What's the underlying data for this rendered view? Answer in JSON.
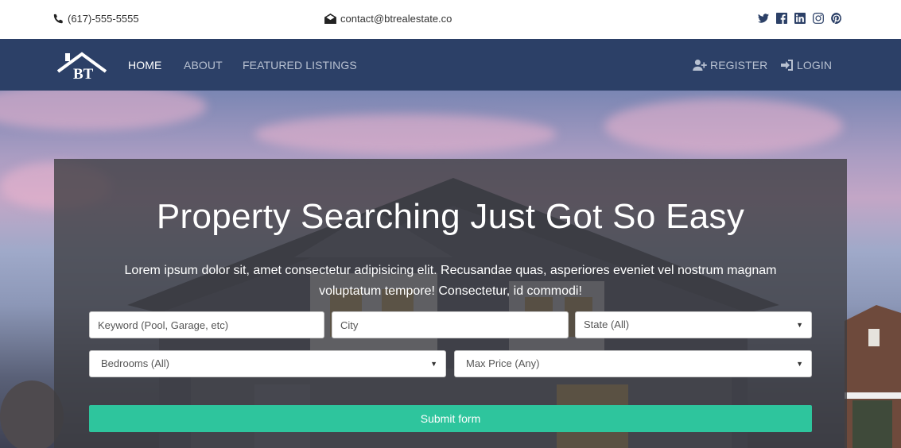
{
  "topbar": {
    "phone": "(617)-555-5555",
    "email": "contact@btrealestate.co",
    "social": [
      "twitter-icon",
      "facebook-icon",
      "linkedin-icon",
      "instagram-icon",
      "pinterest-icon"
    ]
  },
  "navbar": {
    "brand_text": "BT",
    "items": [
      {
        "label": "HOME",
        "active": true
      },
      {
        "label": "ABOUT",
        "active": false
      },
      {
        "label": "FEATURED LISTINGS",
        "active": false
      }
    ],
    "register_label": "REGISTER",
    "login_label": "LOGIN"
  },
  "hero": {
    "title": "Property Searching Just Got So Easy",
    "text": "Lorem ipsum dolor sit, amet consectetur adipisicing elit. Recusandae quas, asperiores eveniet vel nostrum magnam voluptatum tempore! Consectetur, id commodi!"
  },
  "search": {
    "keyword_placeholder": "Keyword (Pool, Garage, etc)",
    "city_placeholder": "City",
    "state_value": "State (All)",
    "bedrooms_value": "Bedrooms (All)",
    "max_price_value": "Max Price (Any)",
    "submit_label": "Submit form"
  },
  "colors": {
    "navbar": "#2c4067",
    "accent": "#2ec59d",
    "overlay": "#3c3c40"
  }
}
